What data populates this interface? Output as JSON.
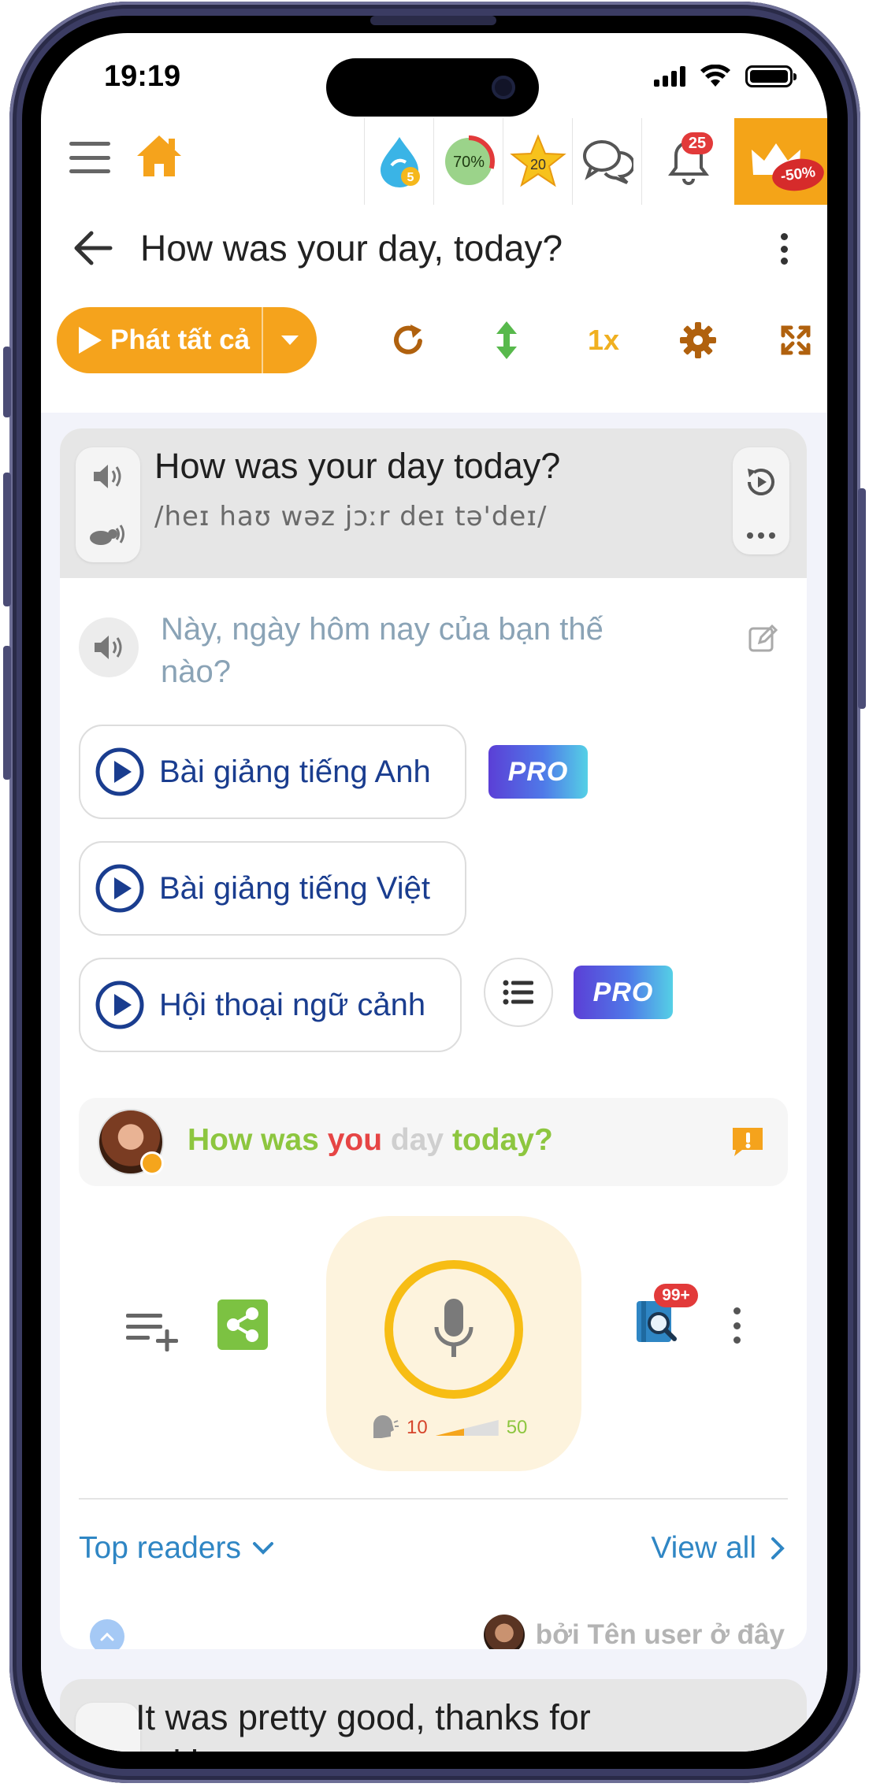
{
  "status_bar": {
    "time": "19:19"
  },
  "toolbar": {
    "streak_count": "5",
    "progress_percent": "70%",
    "star_count": "20",
    "notification_count": "25",
    "premium_discount": "-50%"
  },
  "header": {
    "title": "How was your day, today?"
  },
  "playbar": {
    "play_all_label": "Phát tất cả",
    "speed": "1x"
  },
  "sentence": {
    "text": "How was your day today?",
    "ipa": "/heɪ haʊ wəz jɔːr deɪ tə'deɪ/",
    "translation": "Này, ngày hôm nay của bạn thế nào?"
  },
  "lessons": [
    {
      "label": "Bài giảng tiếng Anh",
      "pro": "PRO"
    },
    {
      "label": "Bài giảng tiếng Việt"
    },
    {
      "label": "Hội thoại ngữ cảnh",
      "pro": "PRO"
    }
  ],
  "recognition": {
    "words": [
      {
        "text": "How was ",
        "status": "good"
      },
      {
        "text": "you ",
        "status": "bad"
      },
      {
        "text": "day ",
        "status": "missing"
      },
      {
        "text": "today?",
        "status": "good"
      }
    ]
  },
  "recorder": {
    "score_min": "10",
    "score_max": "50",
    "dictionary_badge": "99+"
  },
  "readers": {
    "title": "Top readers",
    "view_all": "View all",
    "by_user": "bởi Tên user ở đây"
  },
  "next_sentence": {
    "text": "It was pretty good, thanks for asking."
  },
  "colors": {
    "accent": "#f5a31c",
    "link": "#2f86c4",
    "lesson_text": "#1a3d8f",
    "word_good": "#8dc63f",
    "word_bad": "#e64545",
    "word_missing": "#cfcfcf"
  }
}
